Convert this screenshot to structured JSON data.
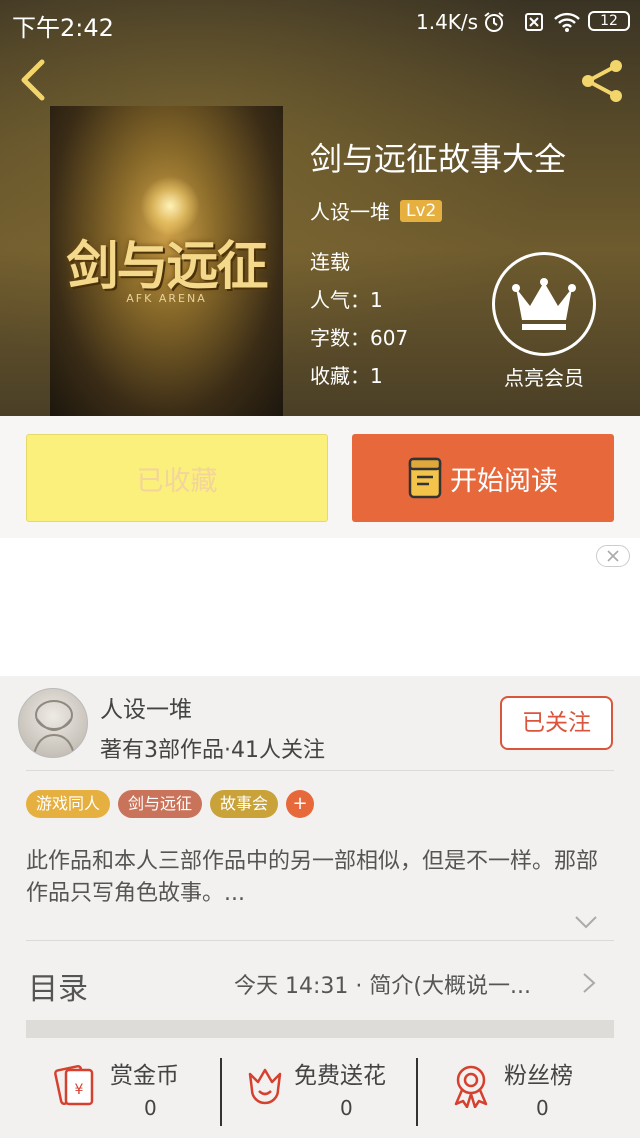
{
  "status_bar": {
    "time": "下午2:42",
    "network_speed": "1.4K/s",
    "battery": "12"
  },
  "header": {
    "back_icon": "chevron-left-icon",
    "share_icon": "share-icon"
  },
  "book": {
    "cover_title": "剑与远征",
    "cover_subtitle": "AFK ARENA",
    "title": "剑与远征故事大全",
    "author": "人设一堆",
    "author_level": "Lv2",
    "status": "连载",
    "popularity": "人气：1",
    "word_count": "字数：607",
    "favorites": "收藏：1"
  },
  "vip": {
    "label": "点亮会员",
    "icon": "crown-icon"
  },
  "actions": {
    "collected_label": "已收藏",
    "read_label": "开始阅读",
    "read_icon": "book-icon"
  },
  "ad": {
    "close_icon": "close-icon"
  },
  "author_card": {
    "name": "人设一堆",
    "stats": "著有3部作品·41人关注",
    "follow_label": "已关注"
  },
  "tags": [
    {
      "label": "游戏同人",
      "color": "#e6b041"
    },
    {
      "label": "剑与远征",
      "color": "#c9735a"
    },
    {
      "label": "故事会",
      "color": "#c9a23a"
    }
  ],
  "tag_add": "+",
  "description": "此作品和本人三部作品中的另一部相似，但是不一样。那部作品只写角色故事。...",
  "toc": {
    "label": "目录",
    "latest": "今天 14:31 · 简介(大概说一..."
  },
  "bottom_bar": {
    "items": [
      {
        "label": "赏金币",
        "value": "0",
        "icon": "red-envelope-icon"
      },
      {
        "label": "免费送花",
        "value": "0",
        "icon": "flower-icon"
      },
      {
        "label": "粉丝榜",
        "value": "0",
        "icon": "medal-icon"
      }
    ]
  },
  "colors": {
    "accent": "#e7693b",
    "collected_bg": "#fbf07b",
    "level_badge": "#e6b041"
  }
}
